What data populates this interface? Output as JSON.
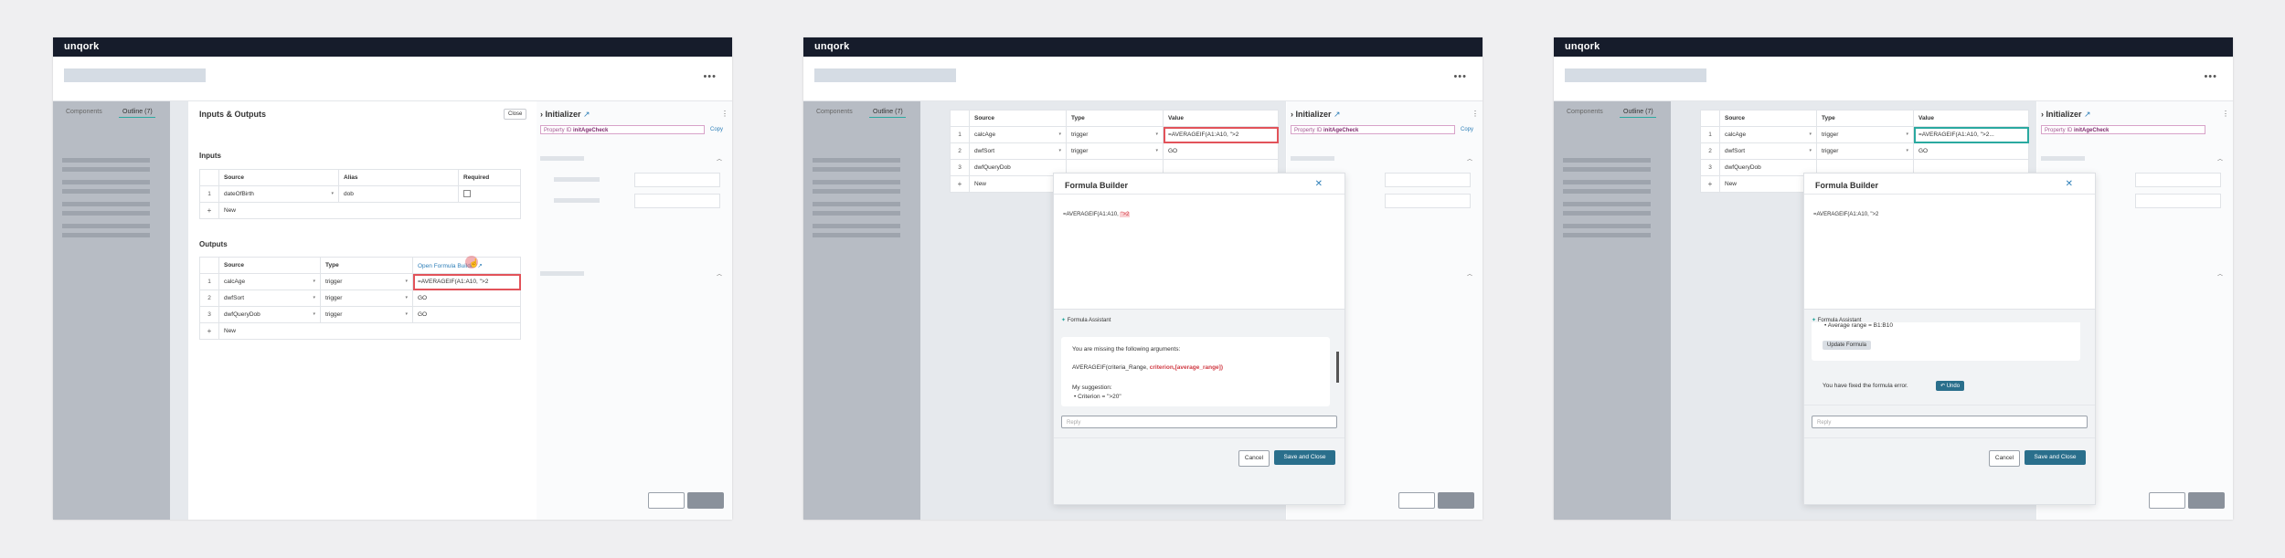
{
  "app": {
    "logo": "unqork",
    "menu_icon": "dots-icon"
  },
  "nav": {
    "components_tab": "Components",
    "outline_tab": "Outline (7)"
  },
  "inspector": {
    "title": "Initializer",
    "property_id_label": "Property ID",
    "property_id_value": "initAgeCheck",
    "copy_label": "Copy"
  },
  "frame1": {
    "panel_title": "Inputs & Outputs",
    "close_label": "Close",
    "inputs_heading": "Inputs",
    "inputs_columns": [
      "Source",
      "Alias",
      "Required"
    ],
    "inputs_rows": [
      {
        "num": "1",
        "source": "dateOfBirth",
        "alias": "dob"
      }
    ],
    "new_label": "New",
    "outputs_heading": "Outputs",
    "outputs_columns": [
      "Source",
      "Type",
      "Open Formula Builder"
    ],
    "outputs_rows": [
      {
        "num": "1",
        "source": "calcAge",
        "type": "trigger",
        "value": "=AVERAGEIF(A1:A10, \">2"
      },
      {
        "num": "2",
        "source": "dwfSort",
        "type": "trigger",
        "value": "GO"
      },
      {
        "num": "3",
        "source": "dwfQueryDob",
        "type": "trigger",
        "value": "GO"
      }
    ]
  },
  "frame2": {
    "columns": [
      "Source",
      "Type",
      "Value"
    ],
    "rows": [
      {
        "num": "1",
        "source": "calcAge",
        "type": "trigger",
        "value": "=AVERAGEIF(A1:A10, \">2"
      },
      {
        "num": "2",
        "source": "dwfSort",
        "type": "trigger",
        "value": "GO"
      },
      {
        "num": "3",
        "source": "dwfQueryDob",
        "type": "",
        "value": ""
      }
    ],
    "new_label": "New",
    "modal": {
      "title": "Formula Builder",
      "formula_prefix": "=AVERAGEIF(A1:A10, ",
      "formula_highlight": "\">2",
      "assistant_label": "Formula Assistant",
      "msg_missing": "You are missing the following arguments:",
      "msg_signature_prefix": "AVERAGEIF(criteria_Range, ",
      "msg_signature_highlight": "criterion,[average_range])",
      "msg_suggestion": "My suggestion:",
      "msg_bullet_1": "Criterion = \">20\"",
      "reply_placeholder": "Reply",
      "cancel_label": "Cancel",
      "save_label": "Save and Close"
    }
  },
  "frame3": {
    "columns": [
      "Source",
      "Type",
      "Value"
    ],
    "rows": [
      {
        "num": "1",
        "source": "calcAge",
        "type": "trigger",
        "value": "=AVERAGEIF(A1:A10, \">2..."
      },
      {
        "num": "2",
        "source": "dwfSort",
        "type": "trigger",
        "value": "GO"
      },
      {
        "num": "3",
        "source": "dwfQueryDob",
        "type": "",
        "value": ""
      }
    ],
    "new_label": "New",
    "modal": {
      "title": "Formula Builder",
      "formula": "=AVERAGEIF(A1:A10, \">2",
      "assistant_label": "Formula Assistant",
      "msg_bullet_avg": "Average range = B1:B10",
      "update_formula_label": "Update Formula",
      "fixed_msg": "You have fixed the formula error.",
      "undo_label": "Undo",
      "reply_placeholder": "Reply",
      "cancel_label": "Cancel",
      "save_label": "Save and Close"
    }
  }
}
